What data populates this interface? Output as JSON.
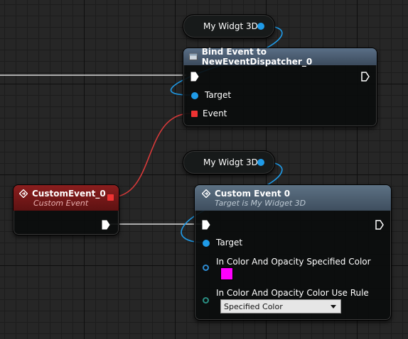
{
  "colors": {
    "exec_wire": "#d8d8d8",
    "object_pin": "#1f9be8",
    "delegate_pin": "#e33333",
    "linear_color_pin": "#2d8bd1",
    "enum_pin": "#2a8f83",
    "swatch": "#ff00ff"
  },
  "var_node_top": {
    "label": "My Widgt 3D",
    "pin_icon": "object-pin-icon"
  },
  "var_node_bottom": {
    "label": "My Widgt 3D",
    "pin_icon": "object-pin-icon"
  },
  "bind_node": {
    "icon": "function-icon",
    "title": "Bind Event to NewEventDispatcher_0",
    "pins": {
      "target": "Target",
      "event": "Event"
    }
  },
  "custom_event_node": {
    "icon": "event-diamond-icon",
    "title": "CustomEvent_0",
    "subtitle": "Custom Event"
  },
  "call_node": {
    "icon": "event-diamond-icon",
    "title": "Custom Event 0",
    "subtitle": "Target is My Widget 3D",
    "pins": {
      "target": "Target",
      "color_label": "In Color And Opacity Specified Color",
      "rule_label": "In Color And Opacity Color Use Rule",
      "rule_value": "Specified Color"
    }
  }
}
